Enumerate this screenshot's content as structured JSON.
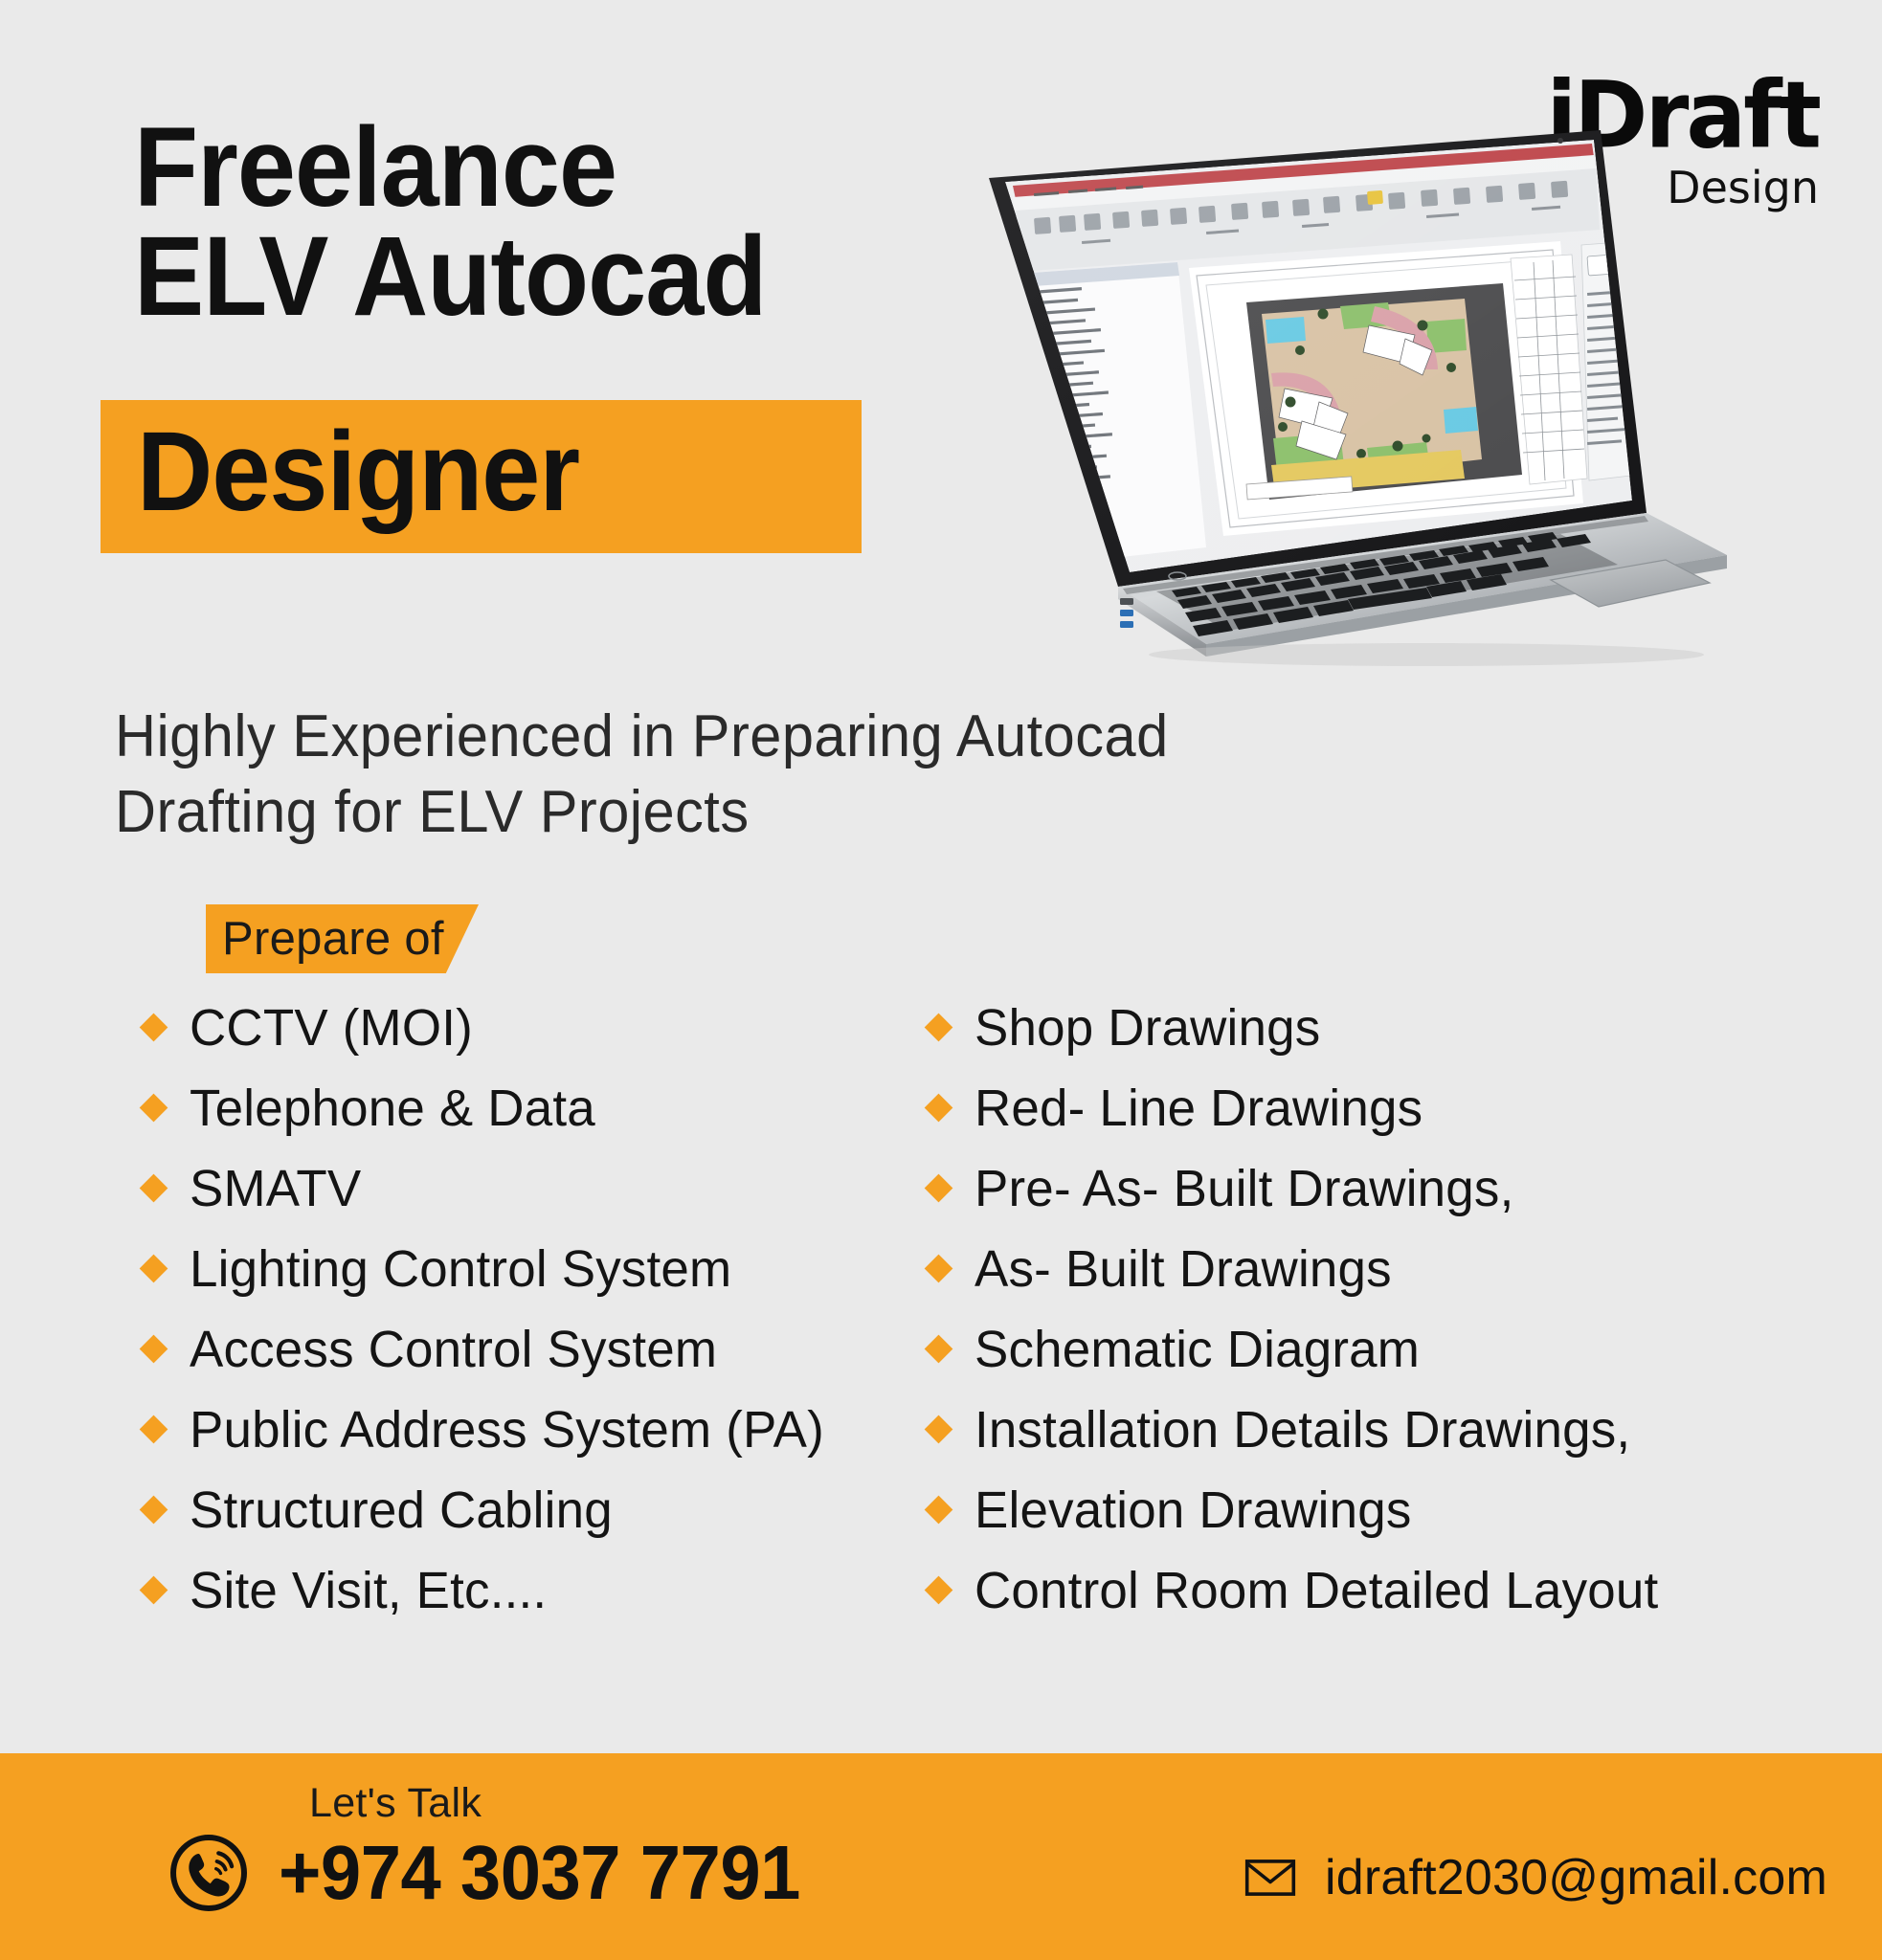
{
  "colors": {
    "background": "#eaeaea",
    "accent_orange": "#f5a021",
    "text_dark": "#111111"
  },
  "headline": {
    "line1": "Freelance",
    "line2": "ELV Autocad",
    "line3_highlighted": "Designer"
  },
  "logo": {
    "name": "iDraft",
    "tagline": "Design"
  },
  "subtitle": {
    "line1": "Highly Experienced in Preparing Autocad",
    "line2": "Drafting for ELV Projects"
  },
  "section_tag": {
    "label": "Prepare of"
  },
  "services": {
    "left_column": [
      "CCTV (MOI)",
      "Telephone & Data",
      "SMATV",
      "Lighting Control System",
      "Access Control System",
      "Public Address System (PA)",
      "Structured Cabling",
      "Site Visit, Etc...."
    ],
    "right_column": [
      "Shop Drawings",
      "Red- Line Drawings",
      "Pre- As- Built Drawings,",
      "As- Built Drawings",
      "Schematic Diagram",
      "Installation Details Drawings,",
      "Elevation Drawings",
      "Control Room Detailed Layout"
    ]
  },
  "footer": {
    "lets_talk_label": "Let's Talk",
    "phone": "+974 3037 7791",
    "email": "idraft2030@gmail.com",
    "phone_icon": "phone-icon",
    "mail_icon": "mail-icon"
  },
  "laptop": {
    "alt": "laptop showing CAD site plan drawing software"
  }
}
